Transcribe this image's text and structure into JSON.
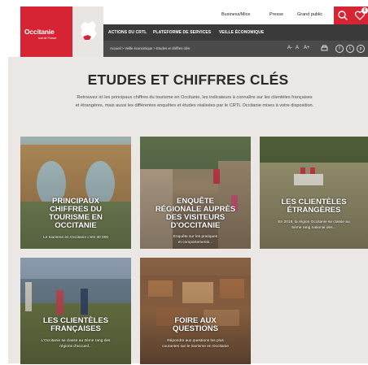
{
  "header": {
    "logo_name": "Occitanie",
    "logo_tagline": "sud de France",
    "utility_links": [
      "Business/Mice",
      "Presse",
      "Grand public"
    ],
    "favorites_count": "0",
    "nav": [
      "ACTIONS DU CRTL",
      "PLATEFORME DE SERVICES",
      "VEILLE ÉCONOMIQUE"
    ],
    "breadcrumb": "Accueil > Veille économique > Etudes et chiffres clés",
    "tools": [
      "A-",
      "A",
      "A+"
    ],
    "social": [
      "f",
      "t",
      "p"
    ]
  },
  "page": {
    "title": "ETUDES ET CHIFFRES CLÉS",
    "intro": [
      "Retrouvez ici les principaux chiffres du tourisme en Occitanie, les indicateurs à connaître sur les clientèles françaises",
      "et étrangères, mais aussi les différentes enquêtes et études réalisées par le CRTL Occitanie mises à votre disposition."
    ]
  },
  "cards": [
    {
      "title": [
        "PRINCIPAUX",
        "CHIFFRES DU",
        "TOURISME EN",
        "OCCITANIE"
      ],
      "desc": [
        "Le tourisme en Occitanie c'est 30 000",
        ""
      ]
    },
    {
      "title": [
        "ENQUÊTE",
        "RÉGIONALE AUPRÈS",
        "DES VISITEURS",
        "D'OCCITANIE"
      ],
      "desc": [
        "Enquête sur les pratiques",
        "et comportements..."
      ]
    },
    {
      "title": [
        "LES CLIENTÈLES",
        "ÉTRANGÈRES"
      ],
      "desc": [
        "En 2018, la région Occitanie se classe au",
        "5ème rang national des..."
      ]
    },
    {
      "title": [
        "LES CLIENTÈLES",
        "FRANÇAISES"
      ],
      "desc": [
        "L'Occitanie se classe au 2ème rang des",
        "régions d'accueil..."
      ]
    },
    {
      "title": [
        "FOIRE AUX",
        "QUESTIONS"
      ],
      "desc": [
        "Répondre aux questions les plus",
        "courantes sur le tourisme en Occitanie"
      ]
    }
  ],
  "colors": {
    "brand_red": "#d62434",
    "nav_dark": "#3a3a3a",
    "intro_bg": "#ebe7e4"
  }
}
